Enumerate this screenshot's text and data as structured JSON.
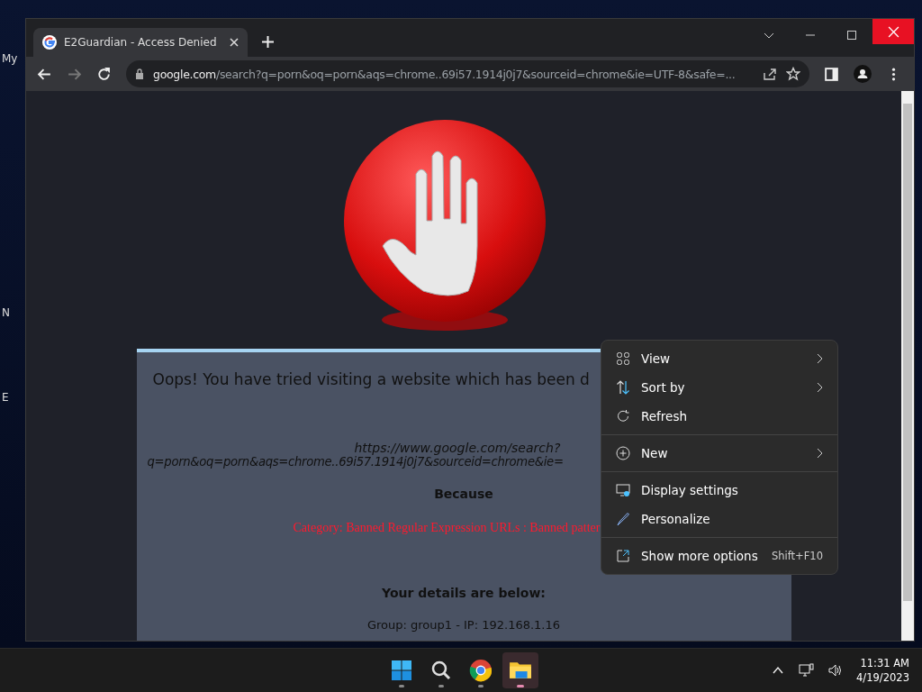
{
  "desktop": {
    "icon_labels": [
      "My",
      "N",
      "E"
    ]
  },
  "browser": {
    "tab": {
      "title": "E2Guardian - Access Denied",
      "selected": true
    },
    "address": {
      "host": "google.com",
      "path": "/search?q=porn&oq=porn&aqs=chrome..69i57.1914j0j7&sourceid=chrome&ie=UTF-8&safe=..."
    }
  },
  "page": {
    "heading": "Oops! You have tried visiting a website which has been d",
    "url_line_1": "https://www.google.com/search?",
    "url_line_2": "q=porn&oq=porn&aqs=chrome..69i57.1914j0j7&sourceid=chrome&ie=",
    "because": "Because",
    "reason": "Category: Banned Regular Expression URLs : Banned patter",
    "details_heading": "Your details are below:",
    "details": "Group: group1 - IP: 192.168.1.16"
  },
  "context_menu": {
    "items": [
      {
        "kind": "item",
        "label": "View",
        "submenu": true
      },
      {
        "kind": "item",
        "label": "Sort by",
        "submenu": true
      },
      {
        "kind": "item",
        "label": "Refresh",
        "submenu": false
      },
      {
        "kind": "separator"
      },
      {
        "kind": "item",
        "label": "New",
        "submenu": true
      },
      {
        "kind": "separator"
      },
      {
        "kind": "item",
        "label": "Display settings",
        "submenu": false
      },
      {
        "kind": "item",
        "label": "Personalize",
        "submenu": false
      },
      {
        "kind": "separator"
      },
      {
        "kind": "item",
        "label": "Show more options",
        "submenu": false,
        "shortcut": "Shift+F10"
      }
    ]
  },
  "taskbar": {
    "apps": [
      {
        "selected": false
      },
      {
        "selected": false
      },
      {
        "selected": false
      },
      {
        "selected": true
      }
    ],
    "time": "11:31 AM",
    "date": "4/19/2023"
  }
}
